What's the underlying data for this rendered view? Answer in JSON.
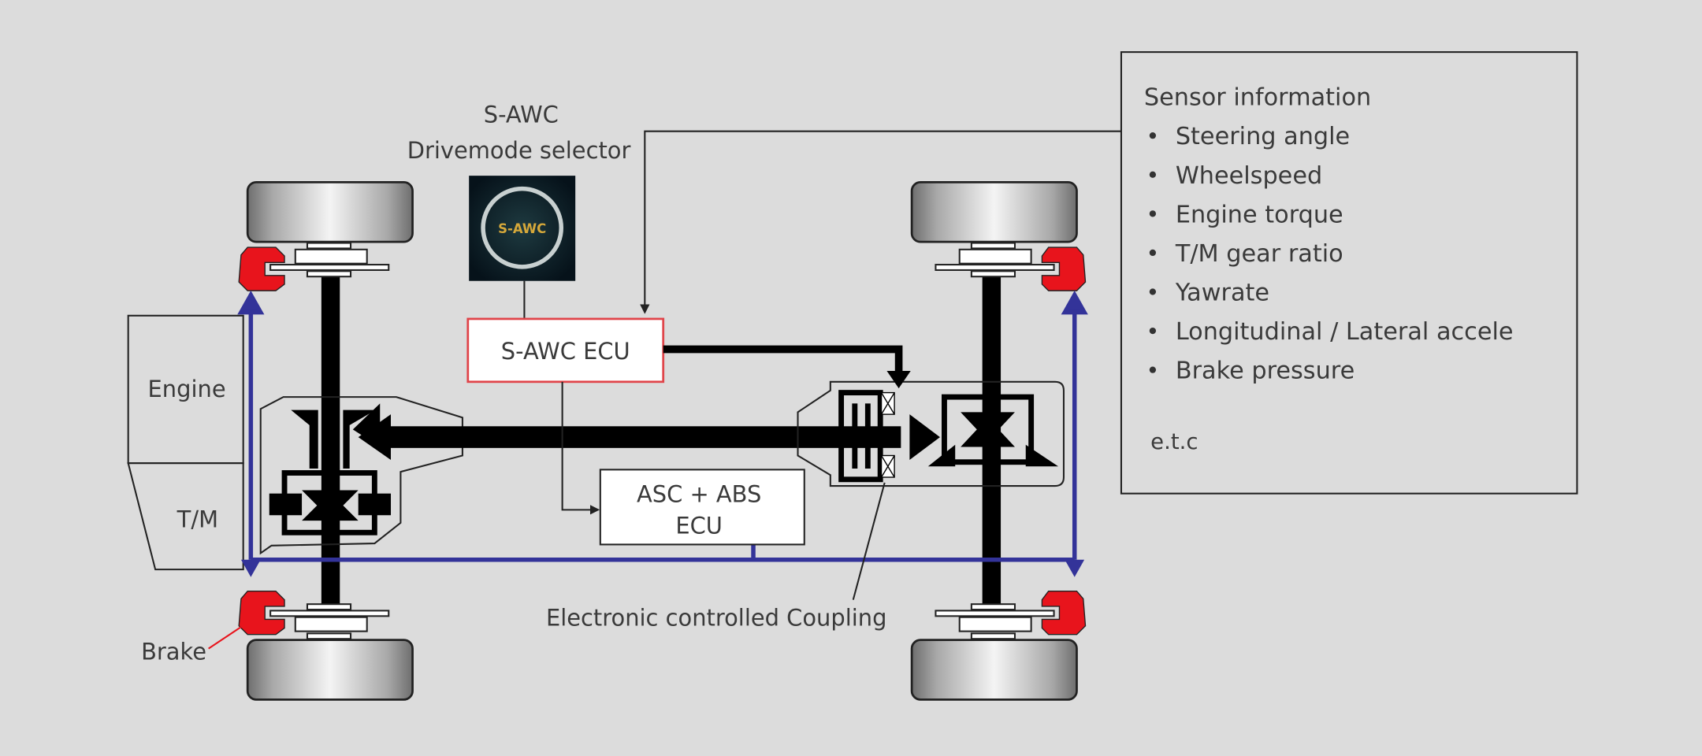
{
  "selector": {
    "title_line1": "S-AWC",
    "title_line2": "Drivemode selector",
    "knob_text": "S-AWC"
  },
  "labels": {
    "engine": "Engine",
    "transmission": "T/M",
    "brake": "Brake",
    "coupling": "Electronic controlled Coupling"
  },
  "ecu": {
    "sawc": "S-AWC ECU",
    "asc_abs_line1": "ASC + ABS",
    "asc_abs_line2": "ECU"
  },
  "sensor_box": {
    "title": "Sensor information",
    "items": [
      "Steering angle",
      "Wheelspeed",
      "Engine torque",
      "T/M gear ratio",
      "Yawrate",
      "Longitudinal / Lateral accele",
      "Brake pressure"
    ],
    "footer": "e.t.c"
  },
  "colors": {
    "background": "#dcdcdc",
    "brake": "#e8141c",
    "signal_line": "#333399",
    "ecu_border": "#e0454a"
  }
}
